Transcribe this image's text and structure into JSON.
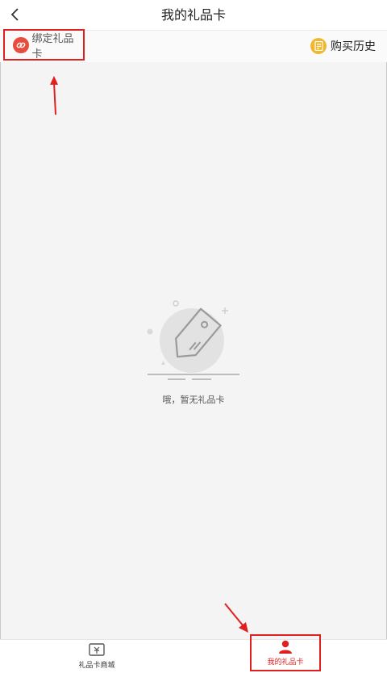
{
  "header": {
    "title": "我的礼品卡",
    "back_icon": "chevron-left-icon"
  },
  "subbar": {
    "bind_label": "绑定礼品卡",
    "bind_icon": "link-icon",
    "history_label": "购买历史",
    "history_icon": "receipt-icon"
  },
  "empty_state": {
    "message": "哦，暂无礼品卡",
    "icon": "tag-icon"
  },
  "tabbar": {
    "tabs": [
      {
        "label": "礼品卡商城",
        "icon": "gift-card-store-icon",
        "active": false
      },
      {
        "label": "我的礼品卡",
        "icon": "user-icon",
        "active": true
      }
    ]
  },
  "colors": {
    "accent": "#e02020",
    "link_icon_bg": "#e74c3c",
    "history_icon_bg": "#f0b830",
    "page_bg": "#f4f4f4"
  }
}
